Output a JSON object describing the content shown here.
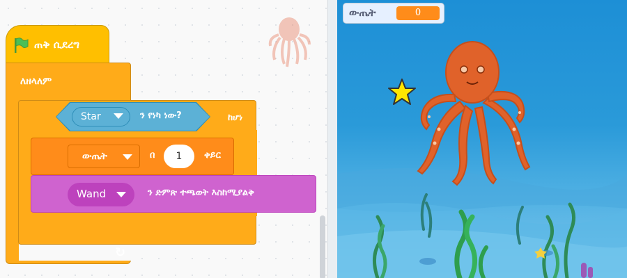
{
  "code": {
    "hat": {
      "label": "ጠቅ ሲደረግ",
      "icon": "green-flag-icon"
    },
    "forever": {
      "label": "ለዘላለም",
      "icon": "loop-arrow-icon"
    },
    "if_block": {
      "sensing_option": "Star",
      "sensing_text": "ን የነካ ነው?",
      "then_text": "ከሆነ"
    },
    "change_block": {
      "variable": "ውጤት",
      "by_text": "በ",
      "amount": "1",
      "tail_text": "ቀይር"
    },
    "touch_block": {
      "option": "Wand",
      "text": "ን ድምጽ ተጫወት እስከሚያልቅ"
    }
  },
  "stage": {
    "monitor": {
      "label": "ውጤት",
      "value": "0"
    },
    "sprites": [
      "octopus",
      "star"
    ]
  },
  "colors": {
    "events": "#ffbf00",
    "control": "#ffab19",
    "sensing": "#5cb1d6",
    "variables": "#ff8c1a",
    "sound": "#cf63cf"
  }
}
